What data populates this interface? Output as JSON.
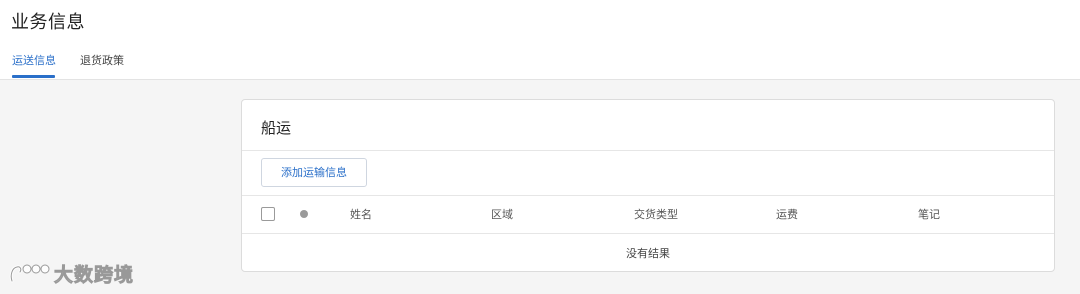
{
  "header": {
    "title": "业务信息",
    "tabs": [
      {
        "label": "运送信息",
        "active": true
      },
      {
        "label": "退货政策",
        "active": false
      }
    ]
  },
  "shipping": {
    "title": "船运",
    "add_button": "添加运输信息",
    "columns": [
      "姓名",
      "区域",
      "交货类型",
      "运费",
      "笔记"
    ],
    "empty_message": "没有结果"
  },
  "watermark": {
    "text": "大数跨境",
    "logo_icon": "dashuju-logo"
  },
  "colors": {
    "accent": "#2a6fc9",
    "background": "#f5f5f5",
    "border": "#dcdcdc"
  }
}
